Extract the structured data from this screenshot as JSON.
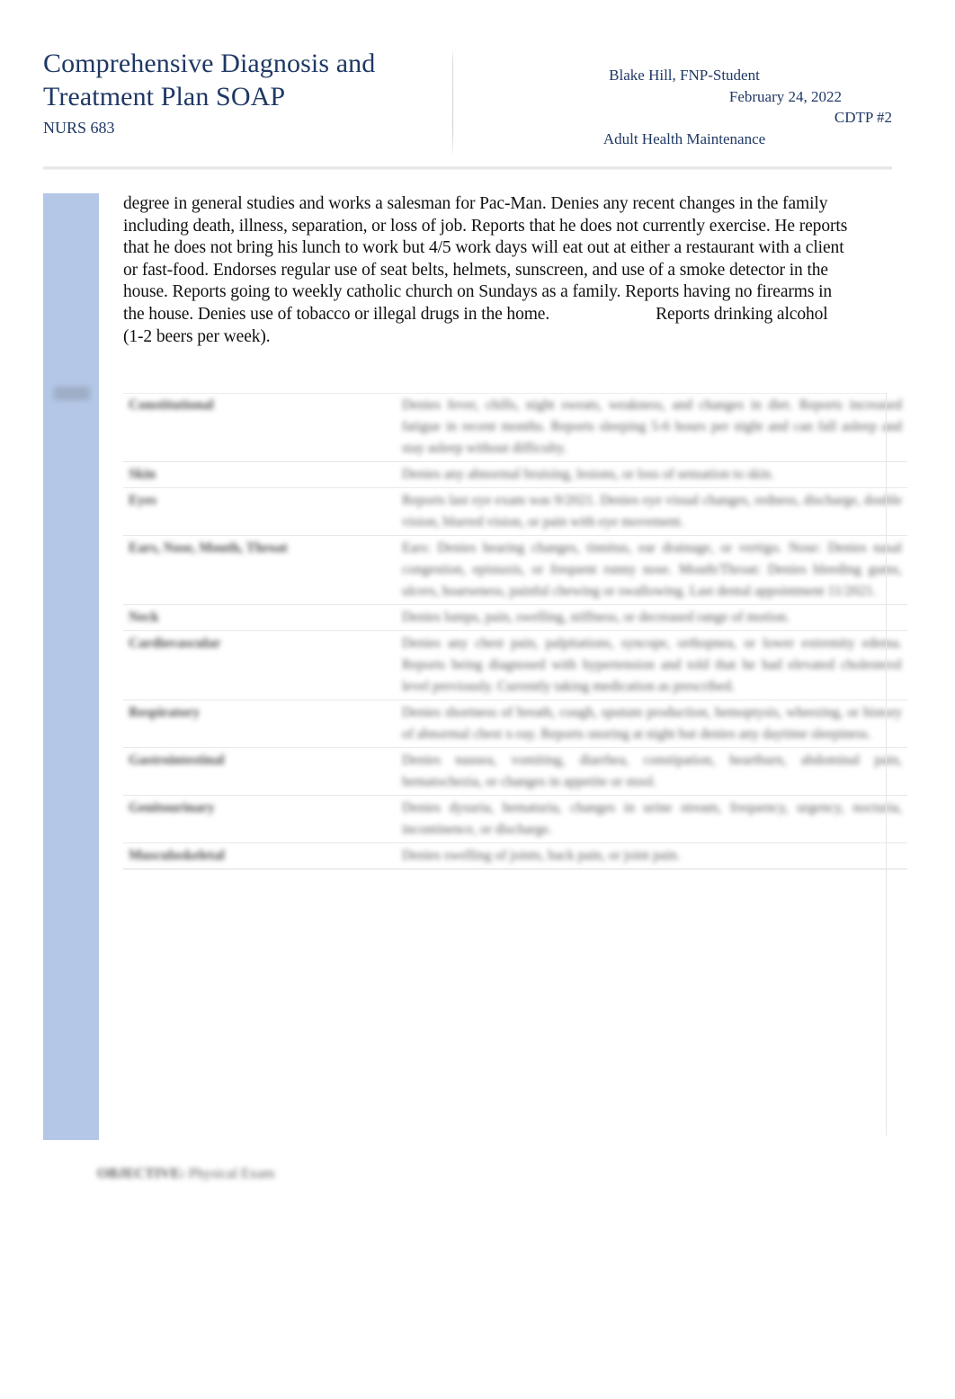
{
  "header": {
    "title": "Comprehensive Diagnosis and Treatment Plan SOAP",
    "course": "NURS 683",
    "author": "Blake Hill, FNP-Student",
    "date": "February 24, 2022",
    "assignment": "CDTP #2",
    "topic": "Adult Health Maintenance"
  },
  "colors": {
    "heading_navy": "#1f3864",
    "rail_blue": "#b4c7e7",
    "body_text": "#111111",
    "table_rule": "#e8e8e8"
  },
  "body": {
    "paragraph_part1": "degree in general studies and works a salesman for Pac-Man. Denies any recent changes in the family including death, illness, separation, or loss of job. Reports that he does not currently exercise. He reports that he does not bring his lunch to work but 4/5 work days will eat out at either a restaurant with a client or fast-food. Endorses regular use of seat belts, helmets, sunscreen, and use of a smoke detector in the house. Reports going to weekly catholic church on Sundays as a family. Reports having no firearms in the house. Denies use of tobacco or illegal drugs in the home.",
    "paragraph_part2": "Reports drinking alcohol (1-2 beers per week)."
  },
  "ros_table": {
    "rows": [
      {
        "label": "Constitutional",
        "value": "Denies fever, chills, night sweats, weakness, and changes in diet. Reports increased fatigue in recent months. Reports sleeping 5-6 hours per night and can fall asleep and stay asleep without difficulty."
      },
      {
        "label": "Skin",
        "value": "Denies any abnormal bruising, lesions, or loss of sensation to skin."
      },
      {
        "label": "Eyes",
        "value": "Reports last eye exam was 9/2021. Denies eye visual changes, redness, discharge, double vision, blurred vision, or pain with eye movement."
      },
      {
        "label": "Ears, Nose, Mouth, Throat",
        "value": "Ears: Denies hearing changes, tinnitus, ear drainage, or vertigo. Nose: Denies nasal congestion, epistaxis, or frequent runny nose. Mouth/Throat: Denies bleeding gums, ulcers, hoarseness, painful chewing or swallowing. Last dental appointment 11/2021."
      },
      {
        "label": "Neck",
        "value": "Denies lumps, pain, swelling, stiffness, or decreased range of motion."
      },
      {
        "label": "Cardiovascular",
        "value": "Denies any chest pain, palpitations, syncope, orthopnea, or lower extremity edema. Reports being diagnosed with hypertension and told that he had elevated cholesterol level previously. Currently taking medication as prescribed."
      },
      {
        "label": "Respiratory",
        "value": "Denies shortness of breath, cough, sputum production, hemoptysis, wheezing, or history of abnormal chest x-ray. Reports snoring at night but denies any daytime sleepiness."
      },
      {
        "label": "Gastrointestinal",
        "value": "Denies nausea, vomiting, diarrhea, constipation, heartburn, abdominal pain, hematochezia, or changes in appetite or stool."
      },
      {
        "label": "Genitourinary",
        "value": "Denies dysuria, hematuria, changes in urine stream, frequency, urgency, nocturia, incontinence, or discharge."
      },
      {
        "label": "Musculoskeletal",
        "value": "Denies swelling of joints, back pain, or joint pain."
      }
    ]
  },
  "footer": {
    "label": "OBJECTIVE:",
    "text": "Physical Exam"
  }
}
